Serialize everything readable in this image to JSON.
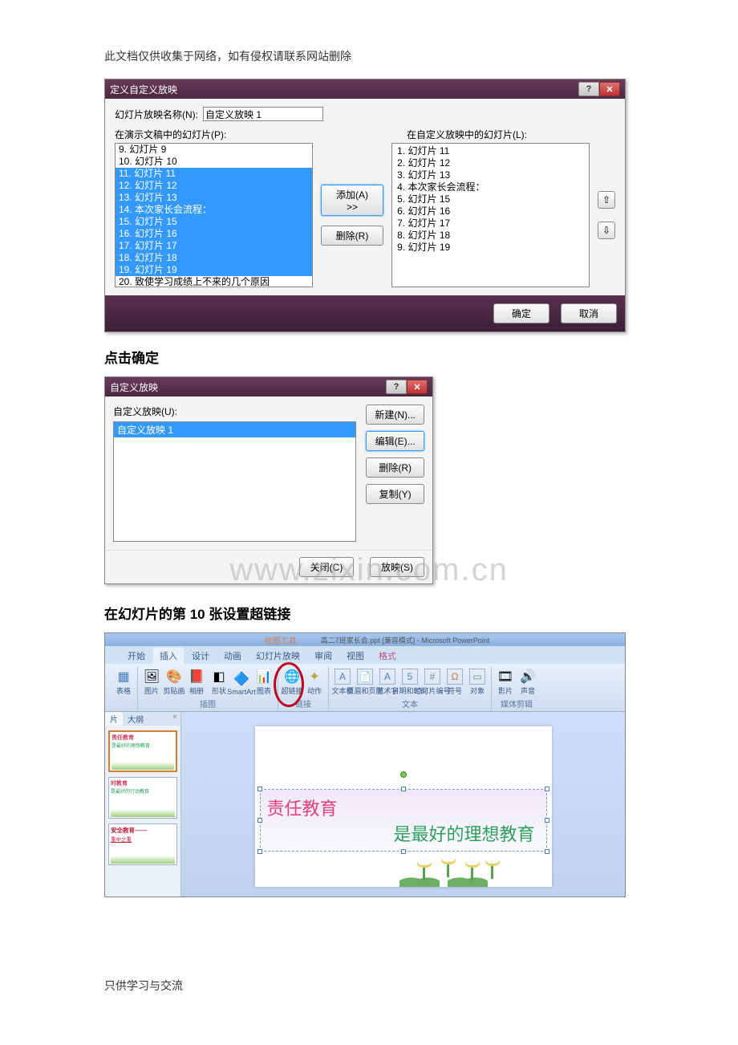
{
  "header": "此文档仅供收集于网络，如有侵权请联系网站删除",
  "footer": "只供学习与交流",
  "watermark": "www.zixin.com.cn",
  "section1_title": "点击确定",
  "section2_title": "在幻灯片的第 10 张设置超链接",
  "dialog1": {
    "title": "定义自定义放映",
    "name_label": "幻灯片放映名称(N):",
    "name_value": "自定义放映 1",
    "left_label": "在演示文稿中的幻灯片(P):",
    "right_label": "在自定义放映中的幻灯片(L):",
    "left_items": [
      {
        "n": "9.",
        "t": "幻灯片 9",
        "sel": false
      },
      {
        "n": "10.",
        "t": "幻灯片 10",
        "sel": false
      },
      {
        "n": "11.",
        "t": "幻灯片 11",
        "sel": true
      },
      {
        "n": "12.",
        "t": "幻灯片 12",
        "sel": true
      },
      {
        "n": "13.",
        "t": "幻灯片 13",
        "sel": true
      },
      {
        "n": "14.",
        "t": "本次家长会流程：",
        "sel": true
      },
      {
        "n": "15.",
        "t": "幻灯片 15",
        "sel": true
      },
      {
        "n": "16.",
        "t": "幻灯片 16",
        "sel": true
      },
      {
        "n": "17.",
        "t": "幻灯片 17",
        "sel": true
      },
      {
        "n": "18.",
        "t": "幻灯片 18",
        "sel": true
      },
      {
        "n": "19.",
        "t": "幻灯片 19",
        "sel": true
      },
      {
        "n": "20.",
        "t": "致使学习成绩上不来的几个原因",
        "sel": false
      }
    ],
    "right_items": [
      {
        "n": "1.",
        "t": "幻灯片 11"
      },
      {
        "n": "2.",
        "t": "幻灯片 12"
      },
      {
        "n": "3.",
        "t": "幻灯片 13"
      },
      {
        "n": "4.",
        "t": "本次家长会流程："
      },
      {
        "n": "5.",
        "t": "幻灯片 15"
      },
      {
        "n": "6.",
        "t": "幻灯片 16"
      },
      {
        "n": "7.",
        "t": "幻灯片 17"
      },
      {
        "n": "8.",
        "t": "幻灯片 18"
      },
      {
        "n": "9.",
        "t": "幻灯片 19"
      }
    ],
    "add_btn": "添加(A) >>",
    "remove_btn": "删除(R)",
    "ok_btn": "确定",
    "cancel_btn": "取消"
  },
  "dialog2": {
    "title": "自定义放映",
    "list_label": "自定义放映(U):",
    "list_item": "自定义放映 1",
    "new_btn": "新建(N)...",
    "edit_btn": "编辑(E)...",
    "delete_btn": "删除(R)",
    "copy_btn": "复制(Y)",
    "close_btn": "关闭(C)",
    "show_btn": "放映(S)"
  },
  "ppt": {
    "title_mid": "绘图工具",
    "title_right": "高二7班家长会.ppt [兼容模式] - Microsoft PowerPoint",
    "tabs": [
      "开始",
      "插入",
      "设计",
      "动画",
      "幻灯片放映",
      "审阅",
      "视图"
    ],
    "tab_extra": "格式",
    "groups": {
      "g1_icons": [
        "表格"
      ],
      "g2_icons": [
        "图片",
        "剪贴画",
        "相册",
        "形状",
        "SmartArt",
        "图表"
      ],
      "g2_label": "插图",
      "g3_icons": [
        "超链接",
        "动作"
      ],
      "g3_label": "链接",
      "g4_icons": [
        "文本框",
        "页眉和页脚",
        "艺术字",
        "日期和时间",
        "幻灯片编号",
        "符号",
        "对象"
      ],
      "g4_label": "文本",
      "g5_icons": [
        "影片",
        "声音"
      ],
      "g5_label": "媒体剪辑"
    },
    "pane_tabs": {
      "a": "片",
      "b": "大纲"
    },
    "thumbs": [
      {
        "l1": "责任教育",
        "l2": "是最好的理想教育"
      },
      {
        "l1": "时教育",
        "l2": "是最好的行动教育"
      },
      {
        "l1": "安全教育——",
        "l2": "重中之重"
      }
    ],
    "slide": {
      "line1": "责任教育",
      "line2": "是最好的理想教育"
    }
  }
}
